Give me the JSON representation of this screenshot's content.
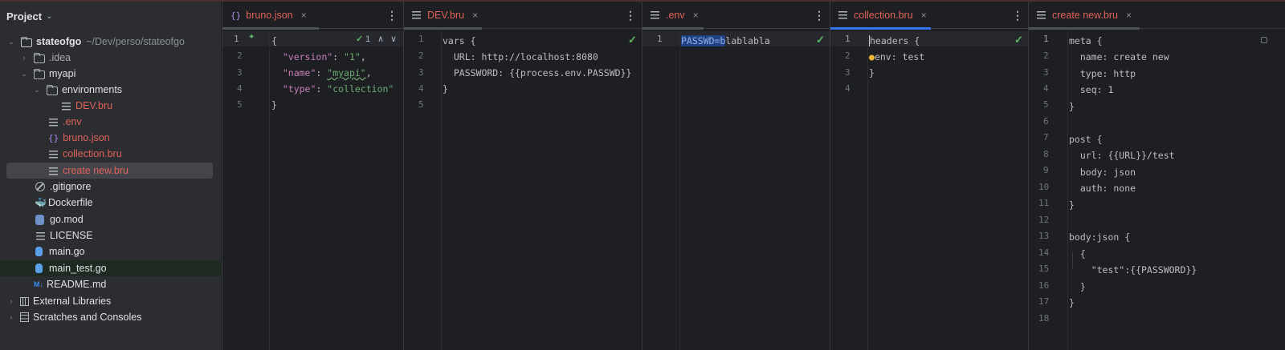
{
  "project_panel": {
    "title": "Project",
    "chevron": "⌄",
    "tree": [
      {
        "label": "stateofgo",
        "path": "~/Dev/perso/stateofgo",
        "icon": "folder-icon",
        "depth": 0,
        "arrow": "⌄"
      },
      {
        "label": ".idea",
        "icon": "folder-icon",
        "depth": 1,
        "arrow": "›"
      },
      {
        "label": "myapi",
        "icon": "folder-icon",
        "depth": 1,
        "arrow": "⌄"
      },
      {
        "label": "environments",
        "icon": "folder-icon",
        "depth": 2,
        "arrow": "⌄"
      },
      {
        "label": "DEV.bru",
        "icon": "file-lines-icon",
        "depth": 3
      },
      {
        "label": ".env",
        "icon": "file-lines-icon",
        "depth": 2
      },
      {
        "label": "bruno.json",
        "icon": "json-icon",
        "depth": 2
      },
      {
        "label": "collection.bru",
        "icon": "file-lines-icon",
        "depth": 2
      },
      {
        "label": "create new.bru",
        "icon": "file-lines-icon",
        "depth": 2
      },
      {
        "label": ".gitignore",
        "icon": "ignore-icon",
        "depth": 1
      },
      {
        "label": "Dockerfile",
        "icon": "docker-icon",
        "depth": 1
      },
      {
        "label": "go.mod",
        "icon": "gomod-icon",
        "depth": 1
      },
      {
        "label": "LICENSE",
        "icon": "file-lines-icon",
        "depth": 1
      },
      {
        "label": "main.go",
        "icon": "go-file-icon",
        "depth": 1
      },
      {
        "label": "main_test.go",
        "icon": "go-file-icon",
        "depth": 1
      },
      {
        "label": "README.md",
        "icon": "markdown-icon",
        "depth": 1
      },
      {
        "label": "External Libraries",
        "icon": "library-icon",
        "depth": 0,
        "arrow": "›"
      },
      {
        "label": "Scratches and Consoles",
        "icon": "scratches-icon",
        "depth": 0,
        "arrow": "›"
      }
    ]
  },
  "editors": [
    {
      "tab_label": "bruno.json",
      "tab_icon": "json-icon",
      "close": "×",
      "menu": "⋮",
      "line_numbers": [
        "1",
        "2",
        "3",
        "4",
        "5"
      ],
      "inlay": {
        "check": "✓",
        "count": "1",
        "up": "∧",
        "down": "∨",
        "change_marker": "✦"
      },
      "lines": {
        "l1": "{",
        "l2_key": "\"version\"",
        "l2_colon": ": ",
        "l2_val": "\"1\"",
        "l2_comma": ",",
        "l3_key": "\"name\"",
        "l3_colon": ": ",
        "l3_val": "\"myapi\"",
        "l3_comma": ",",
        "l4_key": "\"type\"",
        "l4_colon": ": ",
        "l4_val": "\"collection\"",
        "l5": "}"
      }
    },
    {
      "tab_label": "DEV.bru",
      "tab_icon": "file-lines-icon",
      "close": "×",
      "menu": "⋮",
      "check": "✓",
      "line_numbers": [
        "1",
        "2",
        "3",
        "4",
        "5"
      ],
      "lines": [
        "vars {",
        "  URL: http://localhost:8080",
        "  PASSWORD: {{process.env.PASSWD}}",
        "}",
        ""
      ]
    },
    {
      "tab_label": ".env",
      "tab_icon": "file-lines-icon",
      "close": "×",
      "menu": "⋮",
      "check": "✓",
      "line_numbers": [
        "1"
      ],
      "lines": {
        "key": "PASSWD=b",
        "rest": "lablabla"
      }
    },
    {
      "tab_label": "collection.bru",
      "tab_icon": "file-lines-icon",
      "close": "×",
      "menu": "⋮",
      "check": "✓",
      "line_numbers": [
        "1",
        "2",
        "3",
        "4"
      ],
      "lines": {
        "l1": "headers {",
        "l2": "env: test",
        "l3": "}",
        "l4": ""
      }
    },
    {
      "tab_label": "create new.bru",
      "tab_icon": "file-lines-icon",
      "close": "×",
      "menu": "⋮",
      "line_numbers": [
        "1",
        "2",
        "3",
        "4",
        "5",
        "6",
        "7",
        "8",
        "9",
        "10",
        "11",
        "12",
        "13",
        "14",
        "15",
        "16",
        "17",
        "18"
      ],
      "lines": [
        "meta {",
        "  name: create new",
        "  type: http",
        "  seq: 1",
        "}",
        "",
        "post {",
        "  url: {{URL}}/test",
        "  body: json",
        "  auth: none",
        "}",
        "",
        "body:json {",
        "  {",
        "    \"test\":{{PASSWORD}}",
        "  }",
        "}",
        ""
      ]
    }
  ],
  "colors": {
    "background": "#1e1f22",
    "panel": "#2b2d30",
    "vcs_modified": "#e0625b",
    "active_tab_accent": "#3574f0",
    "check_green": "#5fb865"
  }
}
